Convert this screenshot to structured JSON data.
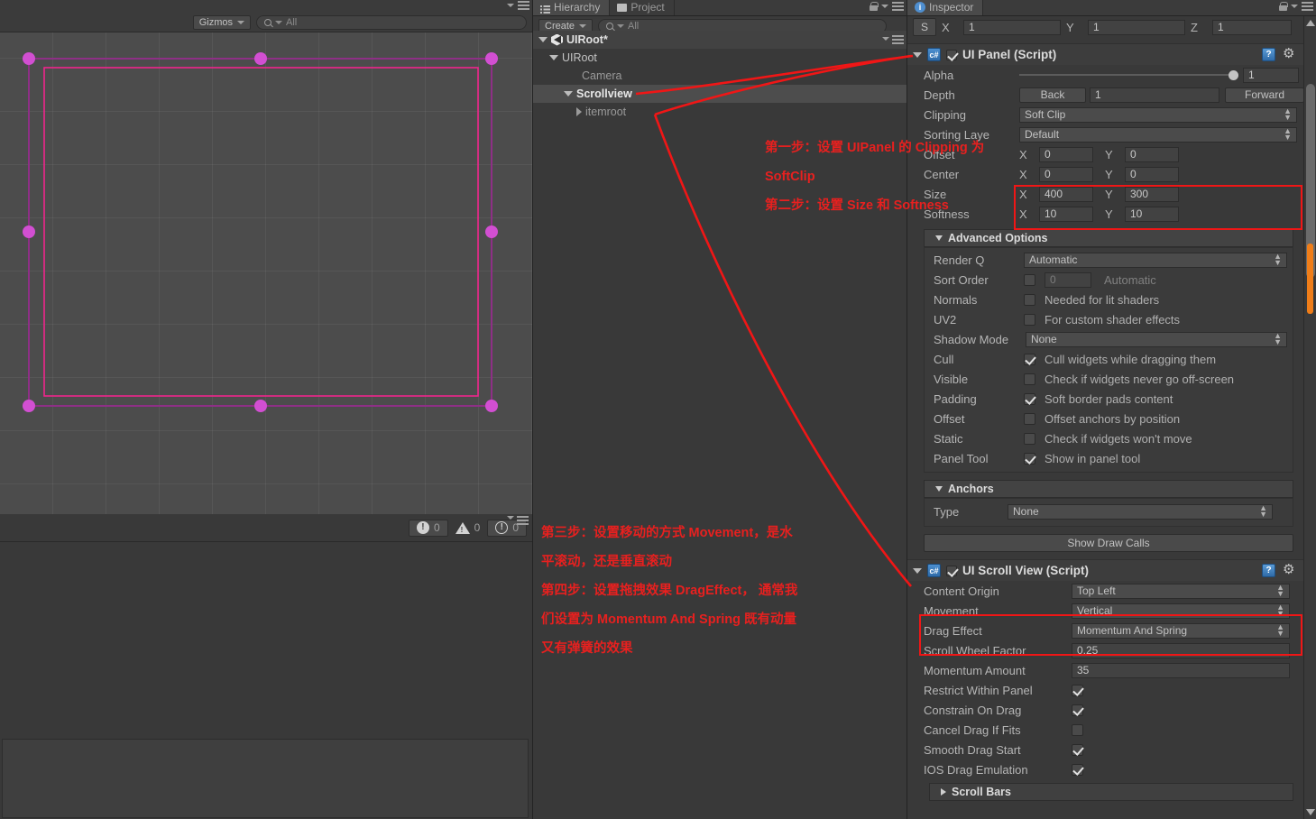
{
  "scene_view": {
    "toolbar": {
      "gizmos_label": "Gizmos",
      "search_placeholder": "All"
    },
    "status": {
      "error_count": "0",
      "warning_count": "0",
      "info_count": "0"
    }
  },
  "hierarchy": {
    "tabs": [
      {
        "label": "Hierarchy",
        "icon": "list-icon",
        "active": true
      },
      {
        "label": "Project",
        "icon": "folder-icon",
        "active": false
      }
    ],
    "toolbar": {
      "create_label": "Create",
      "search_placeholder": "All"
    },
    "items": [
      {
        "label": "UIRoot*",
        "depth": 0,
        "state": "scene-root",
        "expander": "down",
        "icon": "unity-scene-icon"
      },
      {
        "label": "UIRoot",
        "depth": 1,
        "state": "normal",
        "expander": "down"
      },
      {
        "label": "Camera",
        "depth": 2,
        "state": "normal",
        "expander": "none"
      },
      {
        "label": "Scrollview",
        "depth": 2,
        "state": "selected",
        "expander": "down"
      },
      {
        "label": "itemroot",
        "depth": 3,
        "state": "dim",
        "expander": "right"
      }
    ]
  },
  "inspector": {
    "tab_label": "Inspector",
    "transform_scale": {
      "button": "S",
      "x_label": "X",
      "x_value": "1",
      "y_label": "Y",
      "y_value": "1",
      "z_label": "Z",
      "z_value": "1"
    },
    "ui_panel": {
      "title": "UI Panel (Script)",
      "enabled": true,
      "fields": [
        {
          "label": "Alpha",
          "type": "slider",
          "value": "1"
        },
        {
          "label": "Depth",
          "type": "depth",
          "back": "Back",
          "value": "1",
          "forward": "Forward"
        },
        {
          "label": "Clipping",
          "type": "dropdown",
          "value": "Soft Clip"
        },
        {
          "label": "Sorting Laye",
          "type": "dropdown",
          "value": "Default"
        },
        {
          "label": "Offset",
          "type": "xy",
          "x_label": "X",
          "x": "0",
          "y_label": "Y",
          "y": "0"
        },
        {
          "label": "Center",
          "type": "xy",
          "x_label": "X",
          "x": "0",
          "y_label": "Y",
          "y": "0"
        },
        {
          "label": "Size",
          "type": "xy",
          "x_label": "X",
          "x": "400",
          "y_label": "Y",
          "y": "300"
        },
        {
          "label": "Softness",
          "type": "xy",
          "x_label": "X",
          "x": "10",
          "y_label": "Y",
          "y": "10"
        }
      ],
      "advanced_options": {
        "title": "Advanced Options",
        "rows": [
          {
            "label": "Render Q",
            "type": "dropdown",
            "value": "Automatic"
          },
          {
            "label": "Sort Order",
            "type": "check-num",
            "checked": false,
            "num": "0",
            "hint": "Automatic"
          },
          {
            "label": "Normals",
            "type": "check",
            "checked": false,
            "hint": "Needed for lit shaders"
          },
          {
            "label": "UV2",
            "type": "check",
            "checked": false,
            "hint": "For custom shader effects"
          },
          {
            "label": "Shadow Mode",
            "type": "dropdown",
            "value": "None"
          },
          {
            "label": "Cull",
            "type": "check",
            "checked": true,
            "hint": "Cull widgets while dragging them"
          },
          {
            "label": "Visible",
            "type": "check",
            "checked": false,
            "hint": "Check if widgets never go off-screen"
          },
          {
            "label": "Padding",
            "type": "check",
            "checked": true,
            "hint": "Soft border pads content"
          },
          {
            "label": "Offset",
            "type": "check",
            "checked": false,
            "hint": "Offset anchors by position"
          },
          {
            "label": "Static",
            "type": "check",
            "checked": false,
            "hint": "Check if widgets won't move"
          },
          {
            "label": "Panel Tool",
            "type": "check",
            "checked": true,
            "hint": "Show in panel tool"
          }
        ]
      },
      "anchors": {
        "title": "Anchors",
        "type_label": "Type",
        "type_value": "None"
      },
      "show_draw_calls": "Show Draw Calls"
    },
    "ui_scroll_view": {
      "title": "UI Scroll View (Script)",
      "enabled": true,
      "rows": [
        {
          "label": "Content Origin",
          "type": "dropdown",
          "value": "Top Left"
        },
        {
          "label": "Movement",
          "type": "dropdown",
          "value": "Vertical"
        },
        {
          "label": "Drag Effect",
          "type": "dropdown",
          "value": "Momentum And Spring"
        },
        {
          "label": "Scroll Wheel Factor",
          "type": "text",
          "value": "0.25"
        },
        {
          "label": "Momentum Amount",
          "type": "text",
          "value": "35"
        },
        {
          "label": "Restrict Within Panel",
          "type": "check",
          "checked": true
        },
        {
          "label": "Constrain On Drag",
          "type": "check",
          "checked": true
        },
        {
          "label": "Cancel Drag If Fits",
          "type": "check",
          "checked": false
        },
        {
          "label": "Smooth Drag Start",
          "type": "check",
          "checked": true
        },
        {
          "label": "IOS Drag Emulation",
          "type": "check",
          "checked": true
        }
      ],
      "scroll_bars_section": "Scroll Bars"
    }
  },
  "annotations": {
    "color": "#e8201f",
    "step1_line1": "第一步：设置 UIPanel 的 Clipping 为",
    "step1_line2": "SoftClip",
    "step2": "第二步：设置 Size 和 Softness",
    "step3_line1": "第三步：设置移动的方式 Movement，是水",
    "step3_line2": "平滚动，还是垂直滚动",
    "step4_line1": "第四步：设置拖拽效果 DragEffect， 通常我",
    "step4_line2": "们设置为 Momentum And Spring 既有动量",
    "step4_line3": "又有弹簧的效果"
  }
}
